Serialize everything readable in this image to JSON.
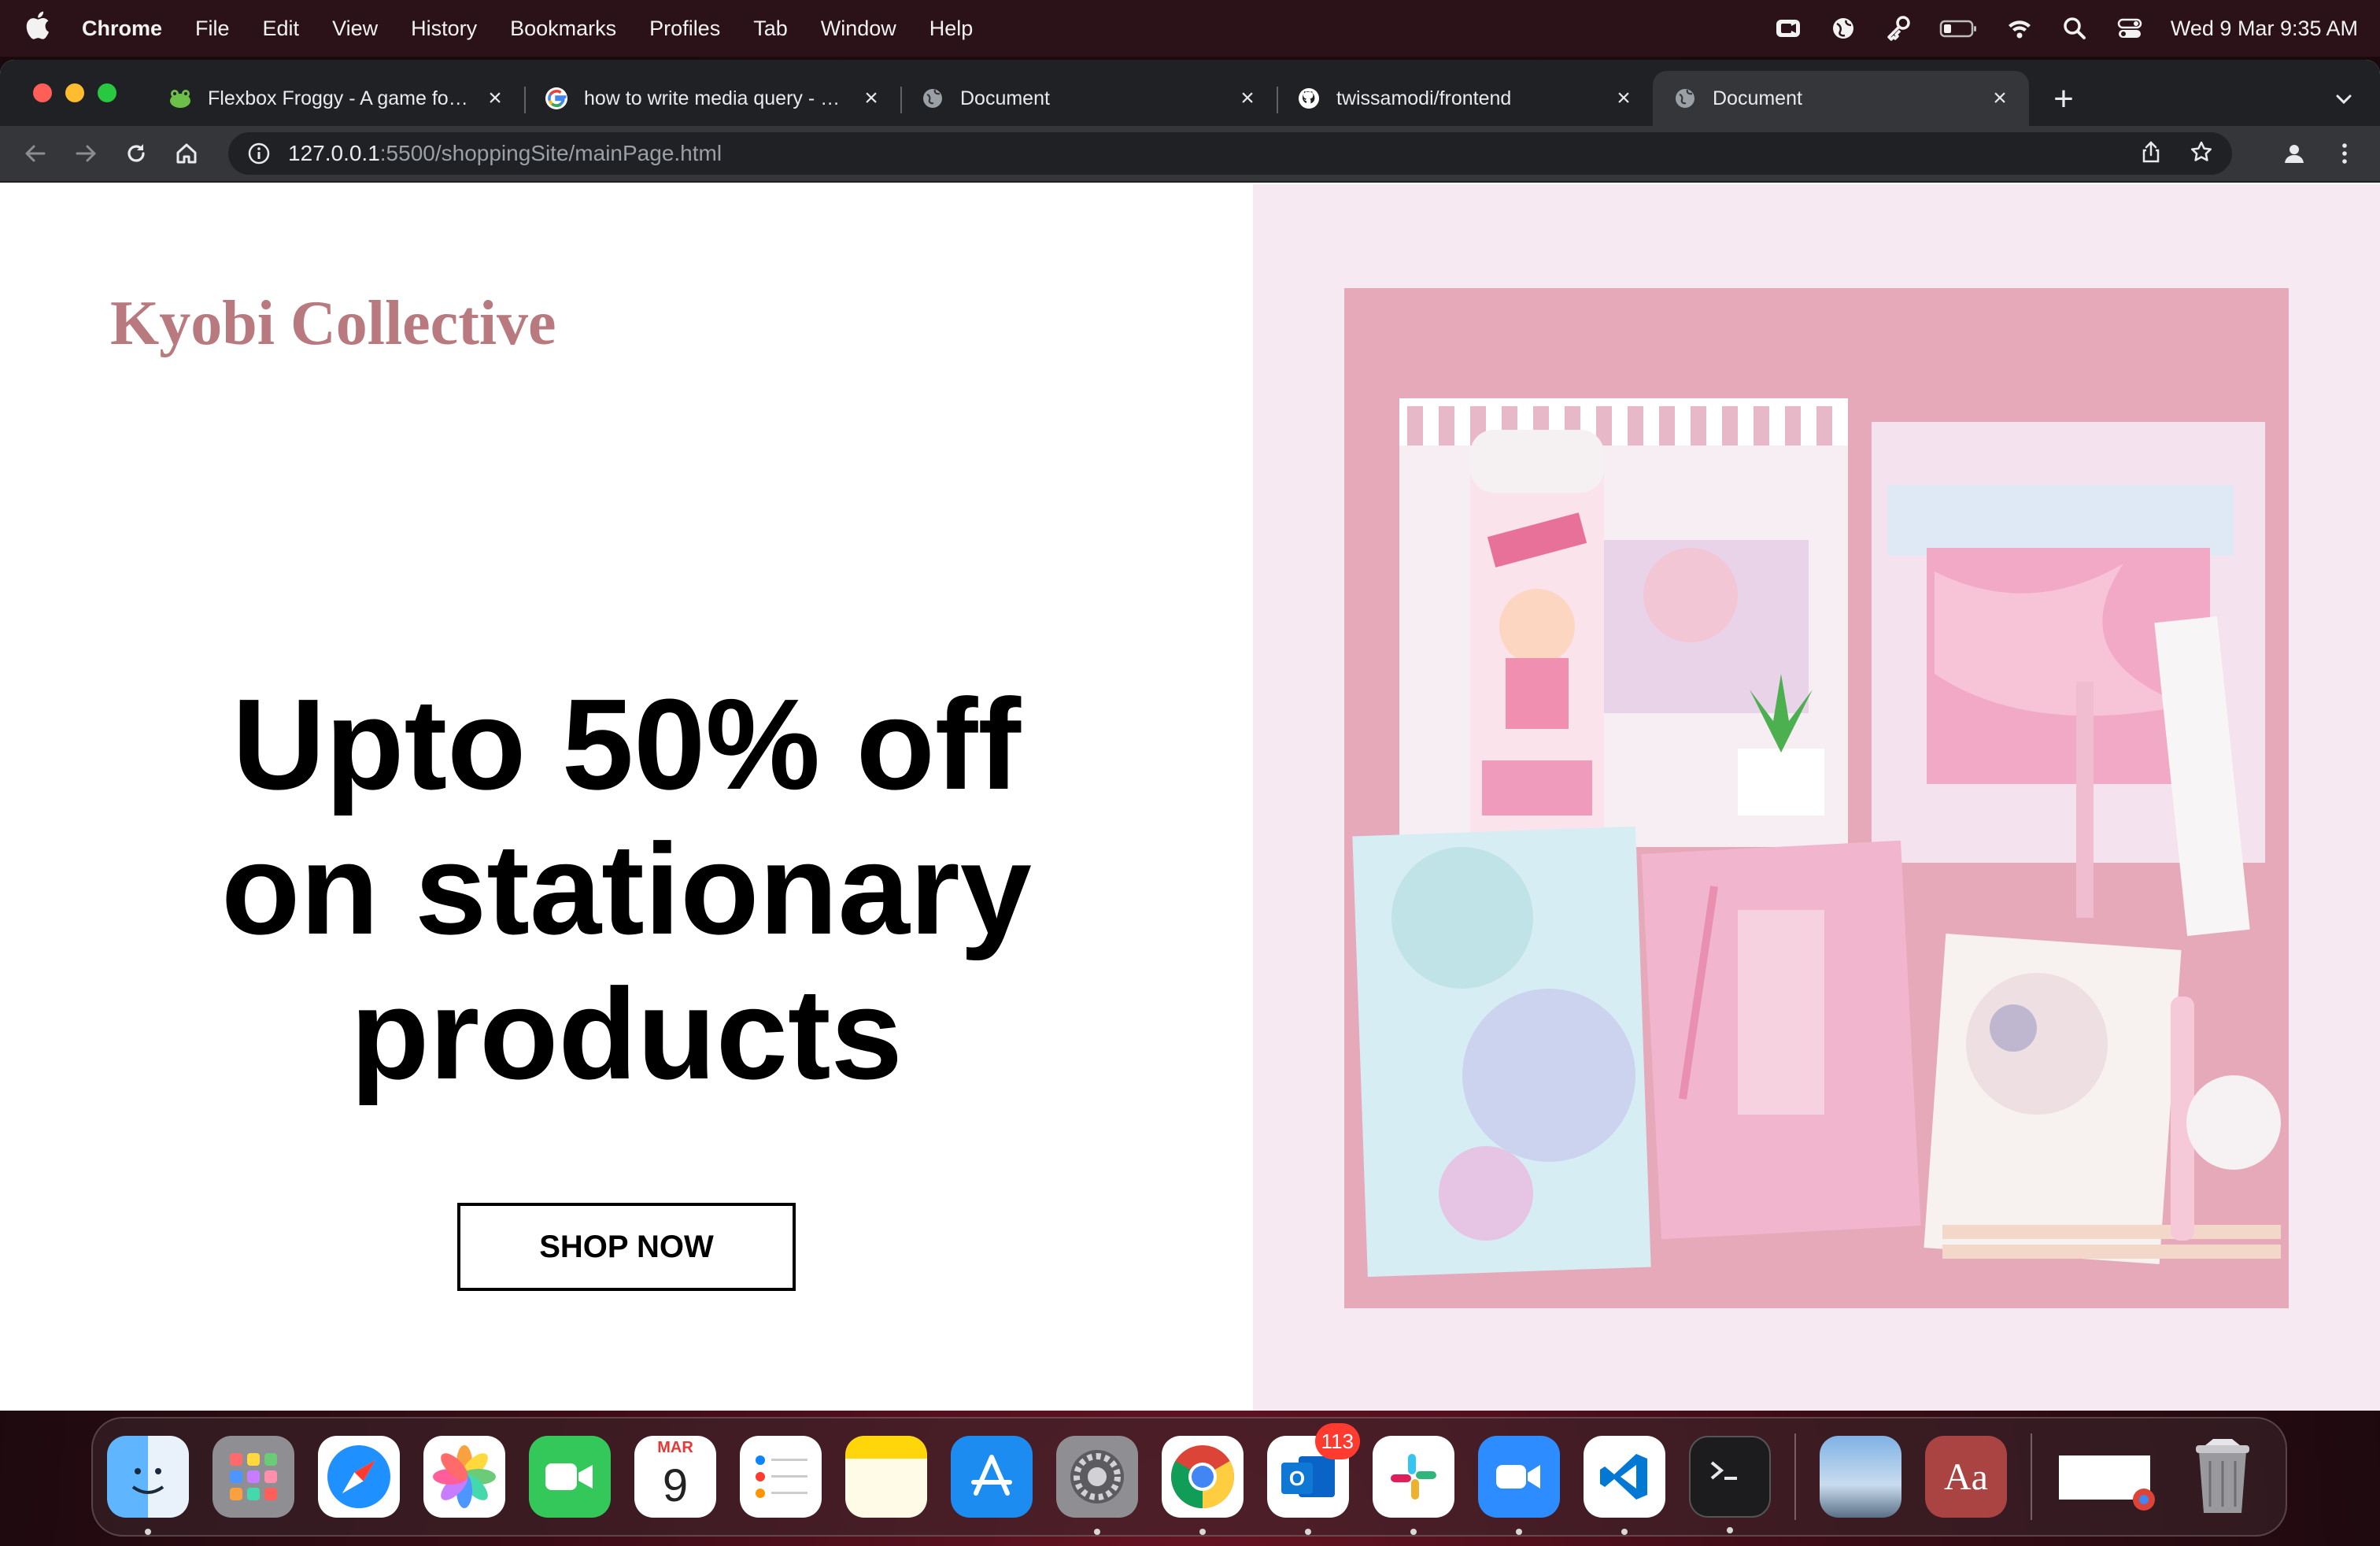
{
  "menubar": {
    "app_name": "Chrome",
    "items": [
      "File",
      "Edit",
      "View",
      "History",
      "Bookmarks",
      "Profiles",
      "Tab",
      "Window",
      "Help"
    ],
    "clock": "Wed 9 Mar  9:35 AM"
  },
  "tabs": [
    {
      "title": "Flexbox Froggy - A game for learning CSS flexbox",
      "icon": "frog-icon"
    },
    {
      "title": "how to write media query - Google Search",
      "icon": "google-icon"
    },
    {
      "title": "Document",
      "icon": "globe-icon"
    },
    {
      "title": "twissamodi/frontend",
      "icon": "github-icon"
    },
    {
      "title": "Document",
      "icon": "globe-icon",
      "active": true
    }
  ],
  "address_bar": {
    "host": "127.0.0.1",
    "rest": ":5500/shoppingSite/mainPage.html"
  },
  "page": {
    "brand": "Kyobi Collective",
    "headline_lines": [
      "Upto 50% off",
      "on stationary",
      "products"
    ],
    "cta_label": "SHOP NOW",
    "colors": {
      "brand": "#b87a7e",
      "right_panel_bg": "#f6e9f1",
      "image_bg": "#e5a9b9"
    }
  },
  "dock": {
    "calendar_month": "MAR",
    "calendar_day": "9",
    "outlook_badge": "113",
    "dictionary_label": "Aa"
  }
}
